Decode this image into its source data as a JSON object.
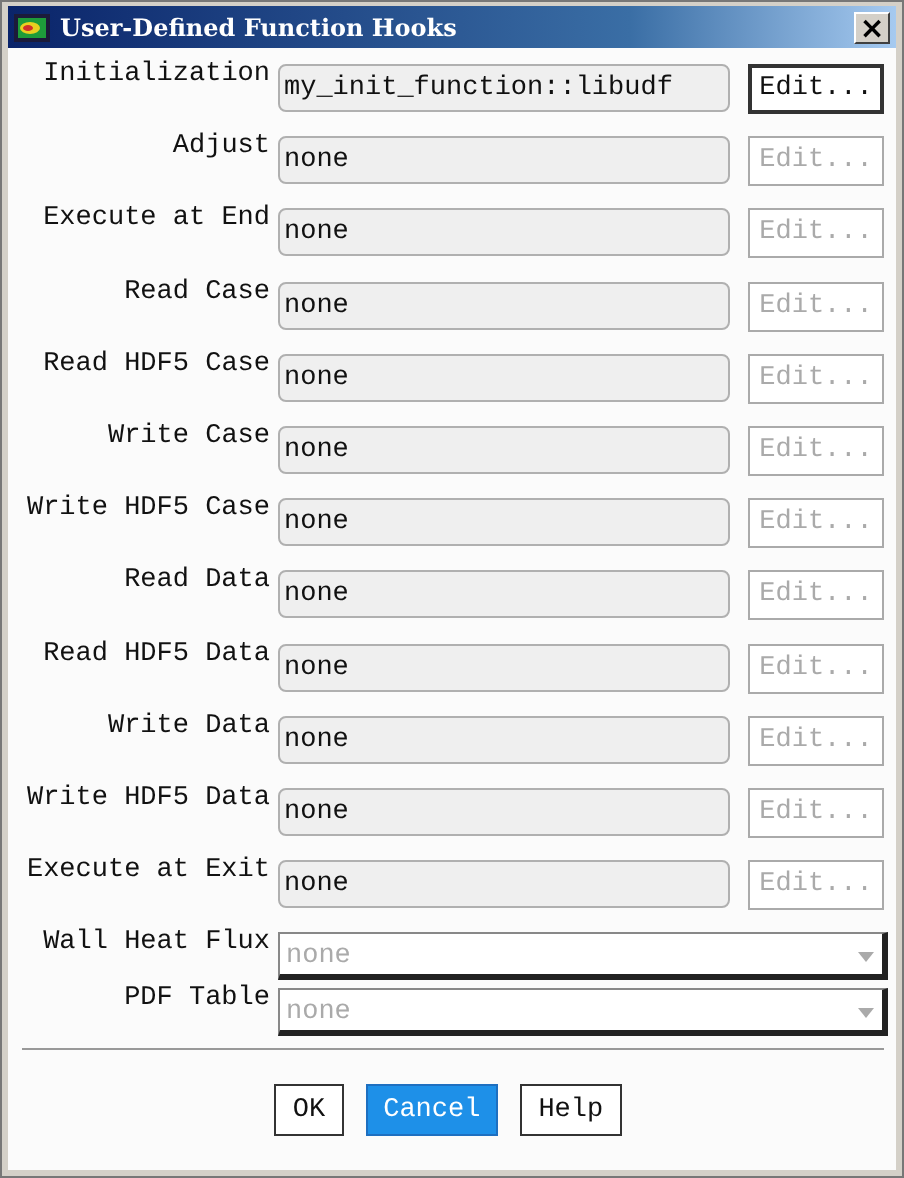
{
  "window": {
    "title": "User-Defined Function Hooks",
    "close": "×"
  },
  "hooks": [
    {
      "kind": "text",
      "label": "Initialization",
      "value": "my_init_function::libudf",
      "button": "Edit...",
      "disabled": false
    },
    {
      "kind": "text",
      "label": "Adjust",
      "value": "none",
      "button": "Edit...",
      "disabled": true
    },
    {
      "kind": "text",
      "label": "Execute at End",
      "value": "none",
      "button": "Edit...",
      "disabled": true
    },
    {
      "kind": "text",
      "label": "Read Case",
      "value": "none",
      "button": "Edit...",
      "disabled": true
    },
    {
      "kind": "text",
      "label": "Read HDF5 Case",
      "value": "none",
      "button": "Edit...",
      "disabled": true
    },
    {
      "kind": "text",
      "label": "Write Case",
      "value": "none",
      "button": "Edit...",
      "disabled": true
    },
    {
      "kind": "text",
      "label": "Write HDF5 Case",
      "value": "none",
      "button": "Edit...",
      "disabled": true
    },
    {
      "kind": "text",
      "label": "Read Data",
      "value": "none",
      "button": "Edit...",
      "disabled": true
    },
    {
      "kind": "text",
      "label": "Read HDF5 Data",
      "value": "none",
      "button": "Edit...",
      "disabled": true
    },
    {
      "kind": "text",
      "label": "Write Data",
      "value": "none",
      "button": "Edit...",
      "disabled": true
    },
    {
      "kind": "text",
      "label": "Write HDF5 Data",
      "value": "none",
      "button": "Edit...",
      "disabled": true
    },
    {
      "kind": "text",
      "label": "Execute at Exit",
      "value": "none",
      "button": "Edit...",
      "disabled": true
    },
    {
      "kind": "dropdown",
      "label": "Wall Heat Flux",
      "value": "none",
      "disabled": true
    },
    {
      "kind": "dropdown",
      "label": "PDF Table",
      "value": "none",
      "disabled": true
    }
  ],
  "buttons": [
    {
      "label": "OK",
      "selected": false
    },
    {
      "label": "Cancel",
      "selected": true
    },
    {
      "label": "Help",
      "selected": false
    }
  ]
}
